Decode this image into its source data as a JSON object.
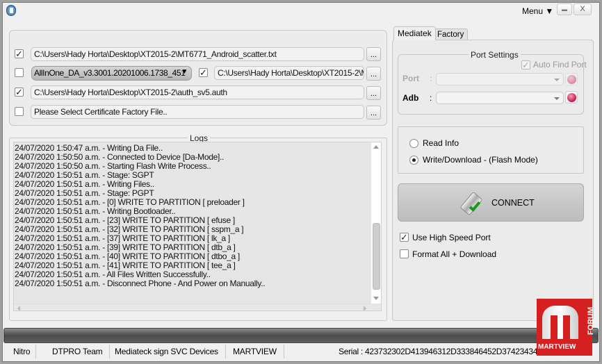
{
  "titlebar": {
    "menu_label": "Menu ▼",
    "minimize_label": "▬",
    "close_label": "X"
  },
  "files": {
    "scatter_checked": true,
    "scatter_path": "C:\\Users\\Hady Horta\\Desktop\\XT2015-2\\MT6771_Android_scatter.txt",
    "da_checked": false,
    "da_selected": "AllInOne_DA_v3.3001.20201006.1738_451",
    "da_file_checked": true,
    "da_file_path": "C:\\Users\\Hady Horta\\Desktop\\XT2015-2\\M",
    "auth_checked": true,
    "auth_path": "C:\\Users\\Hady Horta\\Desktop\\XT2015-2\\auth_sv5.auth",
    "cert_checked": false,
    "cert_path": "Please Select Certificate Factory File..",
    "browse_label": "..."
  },
  "logs": {
    "title": "Logs",
    "lines": [
      "24/07/2020 1:50:47 a.m. - Writing Da File..",
      "24/07/2020 1:50:50 a.m. - Connected to Device [Da-Mode]..",
      "24/07/2020 1:50:50 a.m. - Starting Flash Write Process..",
      "24/07/2020 1:50:51 a.m. - Stage: SGPT",
      "24/07/2020 1:50:51 a.m. - Writing Files..",
      "24/07/2020 1:50:51 a.m. - Stage: PGPT",
      "24/07/2020 1:50:51 a.m. - [0] WRITE TO PARTITION [ preloader ]",
      "24/07/2020 1:50:51 a.m. - Writing Bootloader..",
      "24/07/2020 1:50:51 a.m. - [23] WRITE TO PARTITION [ efuse ]",
      "24/07/2020 1:50:51 a.m. - [32] WRITE TO PARTITION [ sspm_a ]",
      "24/07/2020 1:50:51 a.m. - [37] WRITE TO PARTITION [ lk_a ]",
      "24/07/2020 1:50:51 a.m. - [39] WRITE TO PARTITION [ dtb_a ]",
      "24/07/2020 1:50:51 a.m. - [40] WRITE TO PARTITION [ dtbo_a ]",
      "24/07/2020 1:50:51 a.m. - [41] WRITE TO PARTITION [ tee_a ]",
      "24/07/2020 1:50:51 a.m. - All Files Written Successfully..",
      "24/07/2020 1:50:51 a.m. - Disconnect Phone - And Power on Manually.."
    ]
  },
  "tabs": [
    {
      "label": "Mediatek",
      "active": true
    },
    {
      "label": "Factory",
      "active": false
    }
  ],
  "port_settings": {
    "title": "Port Settings",
    "auto_find_label": "Auto Find Port",
    "auto_find_checked": true,
    "port_label": "Port",
    "adb_label": "Adb",
    "colon": ":"
  },
  "mode": {
    "read_info_label": "Read Info",
    "write_label": "Write/Download - (Flash Mode)",
    "selected": "write"
  },
  "connect_label": "CONNECT",
  "options": {
    "high_speed_label": "Use High Speed Port",
    "high_speed_checked": true,
    "format_label": "Format All + Download",
    "format_checked": false
  },
  "progress": 0,
  "status": {
    "items": [
      "Nitro",
      "DTPRO Team",
      "Mediateck sign SVC Devices",
      "MARTVIEW"
    ],
    "serial": "Serial : 423732302D413946312D333846452D37423434"
  },
  "logo": {
    "text": "MARTVIEW",
    "side_text": "FORUM",
    "color": "#d42020"
  }
}
